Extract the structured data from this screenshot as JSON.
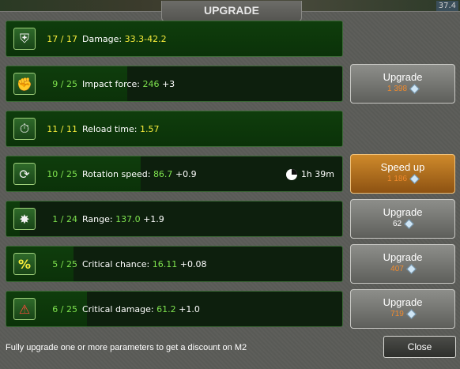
{
  "window": {
    "title": "UPGRADE",
    "corner_value": "37.4"
  },
  "params": [
    {
      "icon": "shield-minus-icon",
      "level": "17 / 17",
      "progress": 1.0,
      "label": "Damage:",
      "value": "33.3-42.2",
      "bonus": ""
    },
    {
      "icon": "fist-icon",
      "level": "9 / 25",
      "progress": 0.36,
      "label": "Impact force:",
      "value": "246",
      "bonus": "+3"
    },
    {
      "icon": "bullet-clock-icon",
      "level": "11 / 11",
      "progress": 1.0,
      "label": "Reload time:",
      "value": "1.57",
      "bonus": ""
    },
    {
      "icon": "rotation-icon",
      "level": "10 / 25",
      "progress": 0.4,
      "label": "Rotation speed:",
      "value": "86.7",
      "bonus": "+0.9"
    },
    {
      "icon": "range-icon",
      "level": "1 / 24",
      "progress": 0.04,
      "label": "Range:",
      "value": "137.0",
      "bonus": "+1.9"
    },
    {
      "icon": "percent-icon",
      "level": "5 / 25",
      "progress": 0.2,
      "label": "Critical chance:",
      "value": "16.11",
      "bonus": "+0.08"
    },
    {
      "icon": "shield-alert-icon",
      "level": "6 / 25",
      "progress": 0.24,
      "label": "Critical damage:",
      "value": "61.2",
      "bonus": "+1.0"
    }
  ],
  "timer": {
    "value": "1h 39m"
  },
  "buttons": [
    {
      "label": "Upgrade",
      "cost": "1 398"
    },
    {
      "label": "Speed up",
      "cost": "1 186"
    },
    {
      "label": "Upgrade",
      "cost": "62"
    },
    {
      "label": "Upgrade",
      "cost": "407"
    },
    {
      "label": "Upgrade",
      "cost": "719"
    }
  ],
  "footer": {
    "hint": "Fully upgrade one or more parameters to get a discount on M2",
    "close_label": "Close"
  },
  "colors": {
    "max_level": "#f6ec3a",
    "partial_level": "#7ee24e",
    "cost_orange": "#f08a2c",
    "speedup_gold": "#cf8a2b"
  }
}
